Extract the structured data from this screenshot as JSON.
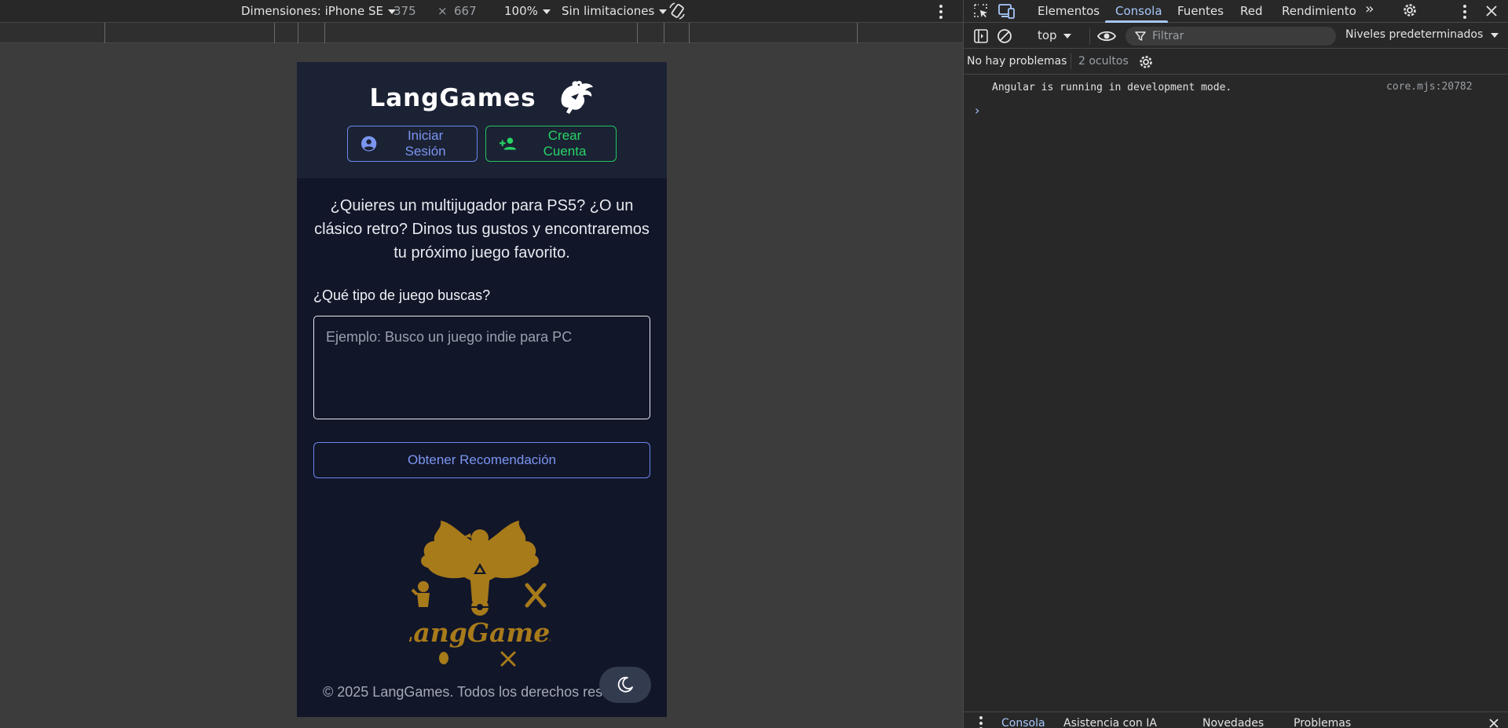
{
  "device_toolbar": {
    "dimensions_label": "Dimensiones: iPhone SE",
    "width": "375",
    "times": "×",
    "height": "667",
    "zoom": "100%",
    "throttling": "Sin limitaciones"
  },
  "site": {
    "brand": "LangGames",
    "login_label": "Iniciar Sesión",
    "signup_label": "Crear Cuenta",
    "intro": "¿Quieres un multijugador para PS5? ¿O un clásico retro? Dinos tus gustos y encontraremos tu próximo juego favorito.",
    "query_label": "¿Qué tipo de juego buscas?",
    "query_placeholder": "Ejemplo: Busco un juego indie para PC",
    "query_value": "",
    "recommend_label": "Obtener Recomendación",
    "footer_logo_text": "LangGames",
    "copyright": "© 2025 LangGames. Todos los derechos reser",
    "colors": {
      "header_bg": "#1b2234",
      "page_bg": "#111629",
      "primary": "#7b95f0",
      "success": "#27d464",
      "gold": "#a77a1a"
    }
  },
  "devtools": {
    "tabs": [
      "Elementos",
      "Consola",
      "Fuentes",
      "Red",
      "Rendimiento"
    ],
    "active_tab": "Consola",
    "context": "top",
    "filter_placeholder": "Filtrar",
    "levels": "Niveles predeterminados",
    "issues": "No hay problemas",
    "hidden": "2 ocultos",
    "log_message": "Angular is running in development mode.",
    "log_source": "core.mjs:20782",
    "drawer_tabs": [
      "Consola",
      "Asistencia con IA",
      "Novedades",
      "Problemas"
    ]
  }
}
